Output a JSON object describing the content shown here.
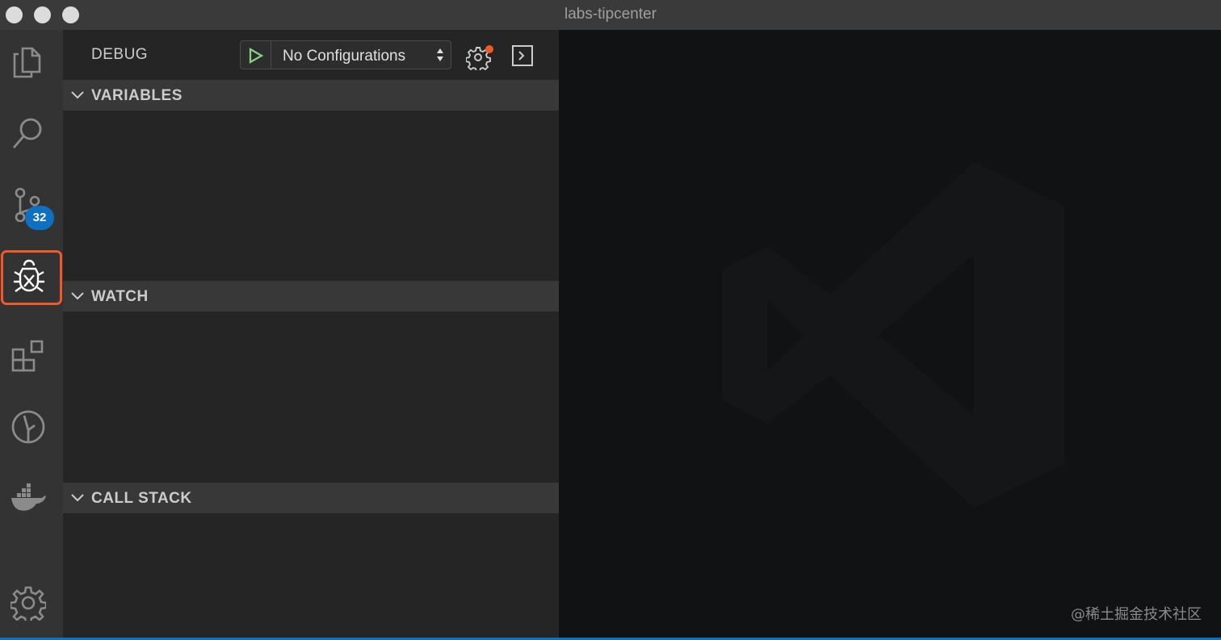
{
  "window": {
    "title": "labs-tipcenter"
  },
  "activity_bar": {
    "items": [
      {
        "icon": "files-icon",
        "active": false
      },
      {
        "icon": "search-icon",
        "active": false
      },
      {
        "icon": "source-control-icon",
        "active": false,
        "badge": "32"
      },
      {
        "icon": "debug-icon",
        "active": true
      },
      {
        "icon": "extensions-icon",
        "active": false
      },
      {
        "icon": "gitlens-icon",
        "active": false
      },
      {
        "icon": "docker-icon",
        "active": false
      },
      {
        "icon": "gear-icon",
        "active": false
      }
    ],
    "accent_color": "#f05a28",
    "badge_color": "#0e70c0"
  },
  "debug": {
    "title": "DEBUG",
    "configuration": "No Configurations",
    "sections": [
      {
        "label": "VARIABLES"
      },
      {
        "label": "WATCH"
      },
      {
        "label": "CALL STACK"
      }
    ]
  },
  "editor": {
    "watermark": "vscode-logo-icon",
    "credit": "@稀土掘金技术社区"
  }
}
